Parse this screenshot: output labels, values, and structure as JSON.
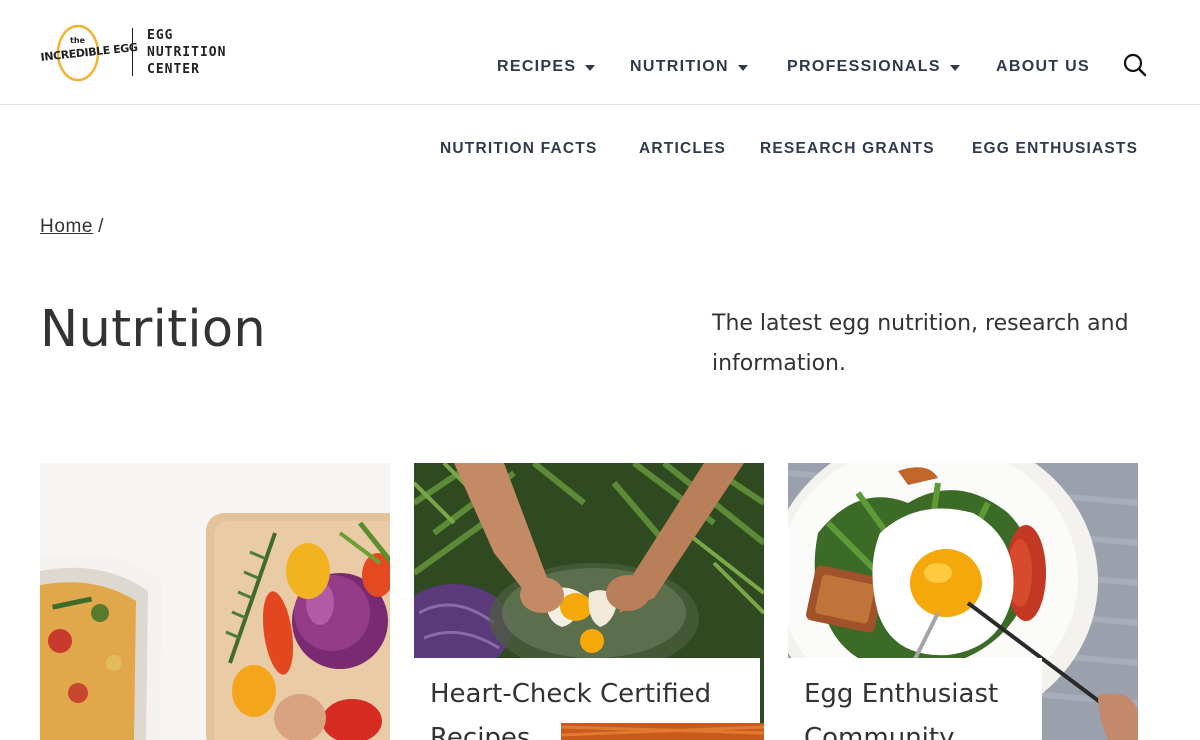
{
  "header": {
    "logo": {
      "the": "the",
      "brand": "INCREDIBLE EGG",
      "lines": [
        "EGG",
        "NUTRITION",
        "CENTER"
      ],
      "accent": "#f2b234"
    },
    "nav": [
      {
        "label": "RECIPES",
        "has_dropdown": true
      },
      {
        "label": "NUTRITION",
        "has_dropdown": true
      },
      {
        "label": "PROFESSIONALS",
        "has_dropdown": true
      },
      {
        "label": "ABOUT US",
        "has_dropdown": false
      }
    ],
    "search_icon": "search-icon"
  },
  "sub_nav": [
    {
      "label": "NUTRITION FACTS"
    },
    {
      "label": "ARTICLES"
    },
    {
      "label": "RESEARCH GRANTS"
    },
    {
      "label": "EGG ENTHUSIASTS"
    }
  ],
  "breadcrumb": {
    "home": "Home",
    "separator": "/"
  },
  "hero": {
    "title": "Nutrition",
    "description": "The latest egg nutrition, research and information."
  },
  "cards": [
    {
      "label": ""
    },
    {
      "label": "Heart-Check Certified Recipes"
    },
    {
      "label": "Egg Enthusiast Community"
    }
  ],
  "colors": {
    "nav_text": "#2e3a4d",
    "body_text": "#333333",
    "yolk": "#f5a80a"
  }
}
